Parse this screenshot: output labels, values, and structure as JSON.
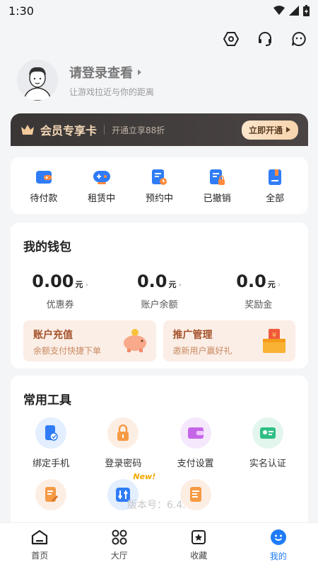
{
  "status_bar": {
    "time": "1:30"
  },
  "profile": {
    "login_text": "请登录查看",
    "subtitle": "让游戏拉近与你的距离"
  },
  "vip": {
    "title": "会员专享卡",
    "desc": "开通立享88折",
    "button": "立即开通"
  },
  "orders": [
    {
      "label": "待付款",
      "icon": "wallet-icon"
    },
    {
      "label": "租赁中",
      "icon": "gamepad-icon"
    },
    {
      "label": "预约中",
      "icon": "clock-doc-icon"
    },
    {
      "label": "已撤销",
      "icon": "lock-doc-icon"
    },
    {
      "label": "全部",
      "icon": "all-orders-icon"
    }
  ],
  "wallet": {
    "title": "我的钱包",
    "stats": [
      {
        "value": "0.00",
        "unit": "元",
        "label": "优惠券"
      },
      {
        "value": "0.0",
        "unit": "元",
        "label": "账户余额"
      },
      {
        "value": "0.0",
        "unit": "元",
        "label": "奖励金"
      }
    ],
    "recharge": {
      "title": "账户充值",
      "sub": "余额支付快捷下单"
    },
    "promo": {
      "title": "推广管理",
      "sub": "邀新用户赢好礼"
    }
  },
  "tools": {
    "title": "常用工具",
    "items": [
      {
        "label": "绑定手机",
        "icon": "phone-bind-icon"
      },
      {
        "label": "登录密码",
        "icon": "padlock-icon"
      },
      {
        "label": "支付设置",
        "icon": "wallet-settings-icon"
      },
      {
        "label": "实名认证",
        "icon": "id-card-icon"
      },
      {
        "label": "",
        "icon": "edit-doc-icon"
      },
      {
        "label": "",
        "icon": "settings-sliders-icon"
      },
      {
        "label": "",
        "icon": "help-doc-icon"
      }
    ],
    "new_badge": "New!"
  },
  "version_text": "版本号：6.4.",
  "tabs": [
    {
      "label": "首页",
      "icon": "home-icon"
    },
    {
      "label": "大厅",
      "icon": "grid-icon"
    },
    {
      "label": "收藏",
      "icon": "favorite-icon"
    },
    {
      "label": "我的",
      "icon": "profile-icon",
      "active": true
    }
  ],
  "colors": {
    "accent": "#1e7cf6",
    "vip_bg": "#3a3635",
    "vip_gold": "#f3d7b6"
  }
}
